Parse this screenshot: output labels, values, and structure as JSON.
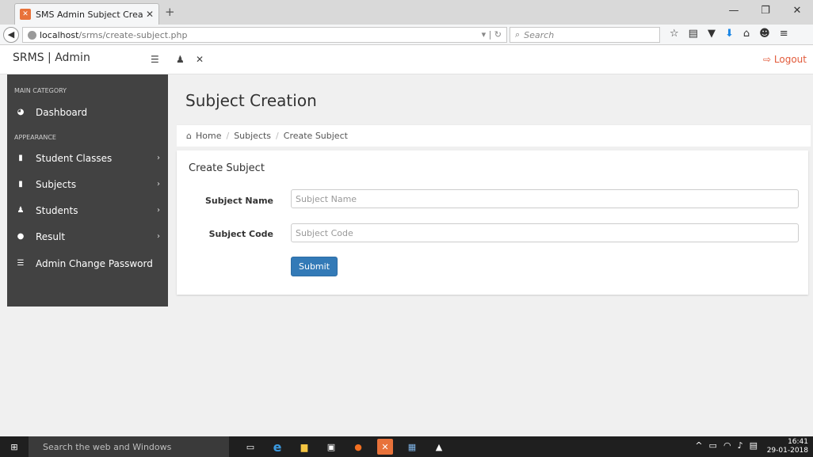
{
  "browser": {
    "tab_title": "SMS Admin Subject Creati...",
    "new_tab_label": "+",
    "url_host": "localhost",
    "url_path": "/srms/create-subject.php",
    "search_placeholder": "Search"
  },
  "header": {
    "brand": "SRMS | Admin",
    "logout_label": "Logout"
  },
  "sidebar": {
    "categories": [
      "MAIN CATEGORY",
      "APPEARANCE"
    ],
    "items": [
      {
        "label": "Dashboard",
        "icon": "dashboard-icon"
      },
      {
        "label": "Student Classes",
        "icon": "file-icon"
      },
      {
        "label": "Subjects",
        "icon": "file-icon"
      },
      {
        "label": "Students",
        "icon": "users-icon"
      },
      {
        "label": "Result",
        "icon": "info-icon"
      },
      {
        "label": "Admin Change Password",
        "icon": "list-icon"
      }
    ]
  },
  "page": {
    "title": "Subject Creation",
    "breadcrumb": [
      "Home",
      "Subjects",
      "Create Subject"
    ],
    "sep": "/"
  },
  "form": {
    "heading": "Create Subject",
    "subject_name_label": "Subject Name",
    "subject_name_placeholder": "Subject Name",
    "subject_code_label": "Subject Code",
    "subject_code_placeholder": "Subject Code",
    "submit_label": "Submit"
  },
  "taskbar": {
    "search_text": "Search the web and Windows",
    "time": "16:41",
    "date": "29-01-2018"
  },
  "colors": {
    "sidebar_bg": "#424242",
    "primary_button": "#337ab7",
    "logout": "#e25a3a"
  }
}
